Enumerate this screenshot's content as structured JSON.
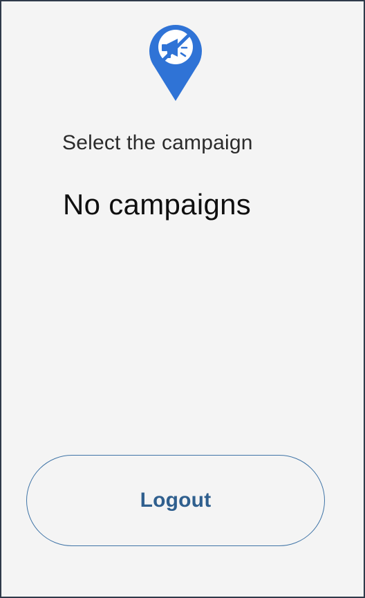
{
  "header": {
    "logo_icon": "location-pin-megaphone-muted-icon",
    "brand_color": "#2f73d6"
  },
  "campaign_selection": {
    "label": "Select the campaign",
    "empty_message": "No campaigns"
  },
  "actions": {
    "logout_label": "Logout",
    "logout_color": "#2f5f8e"
  }
}
